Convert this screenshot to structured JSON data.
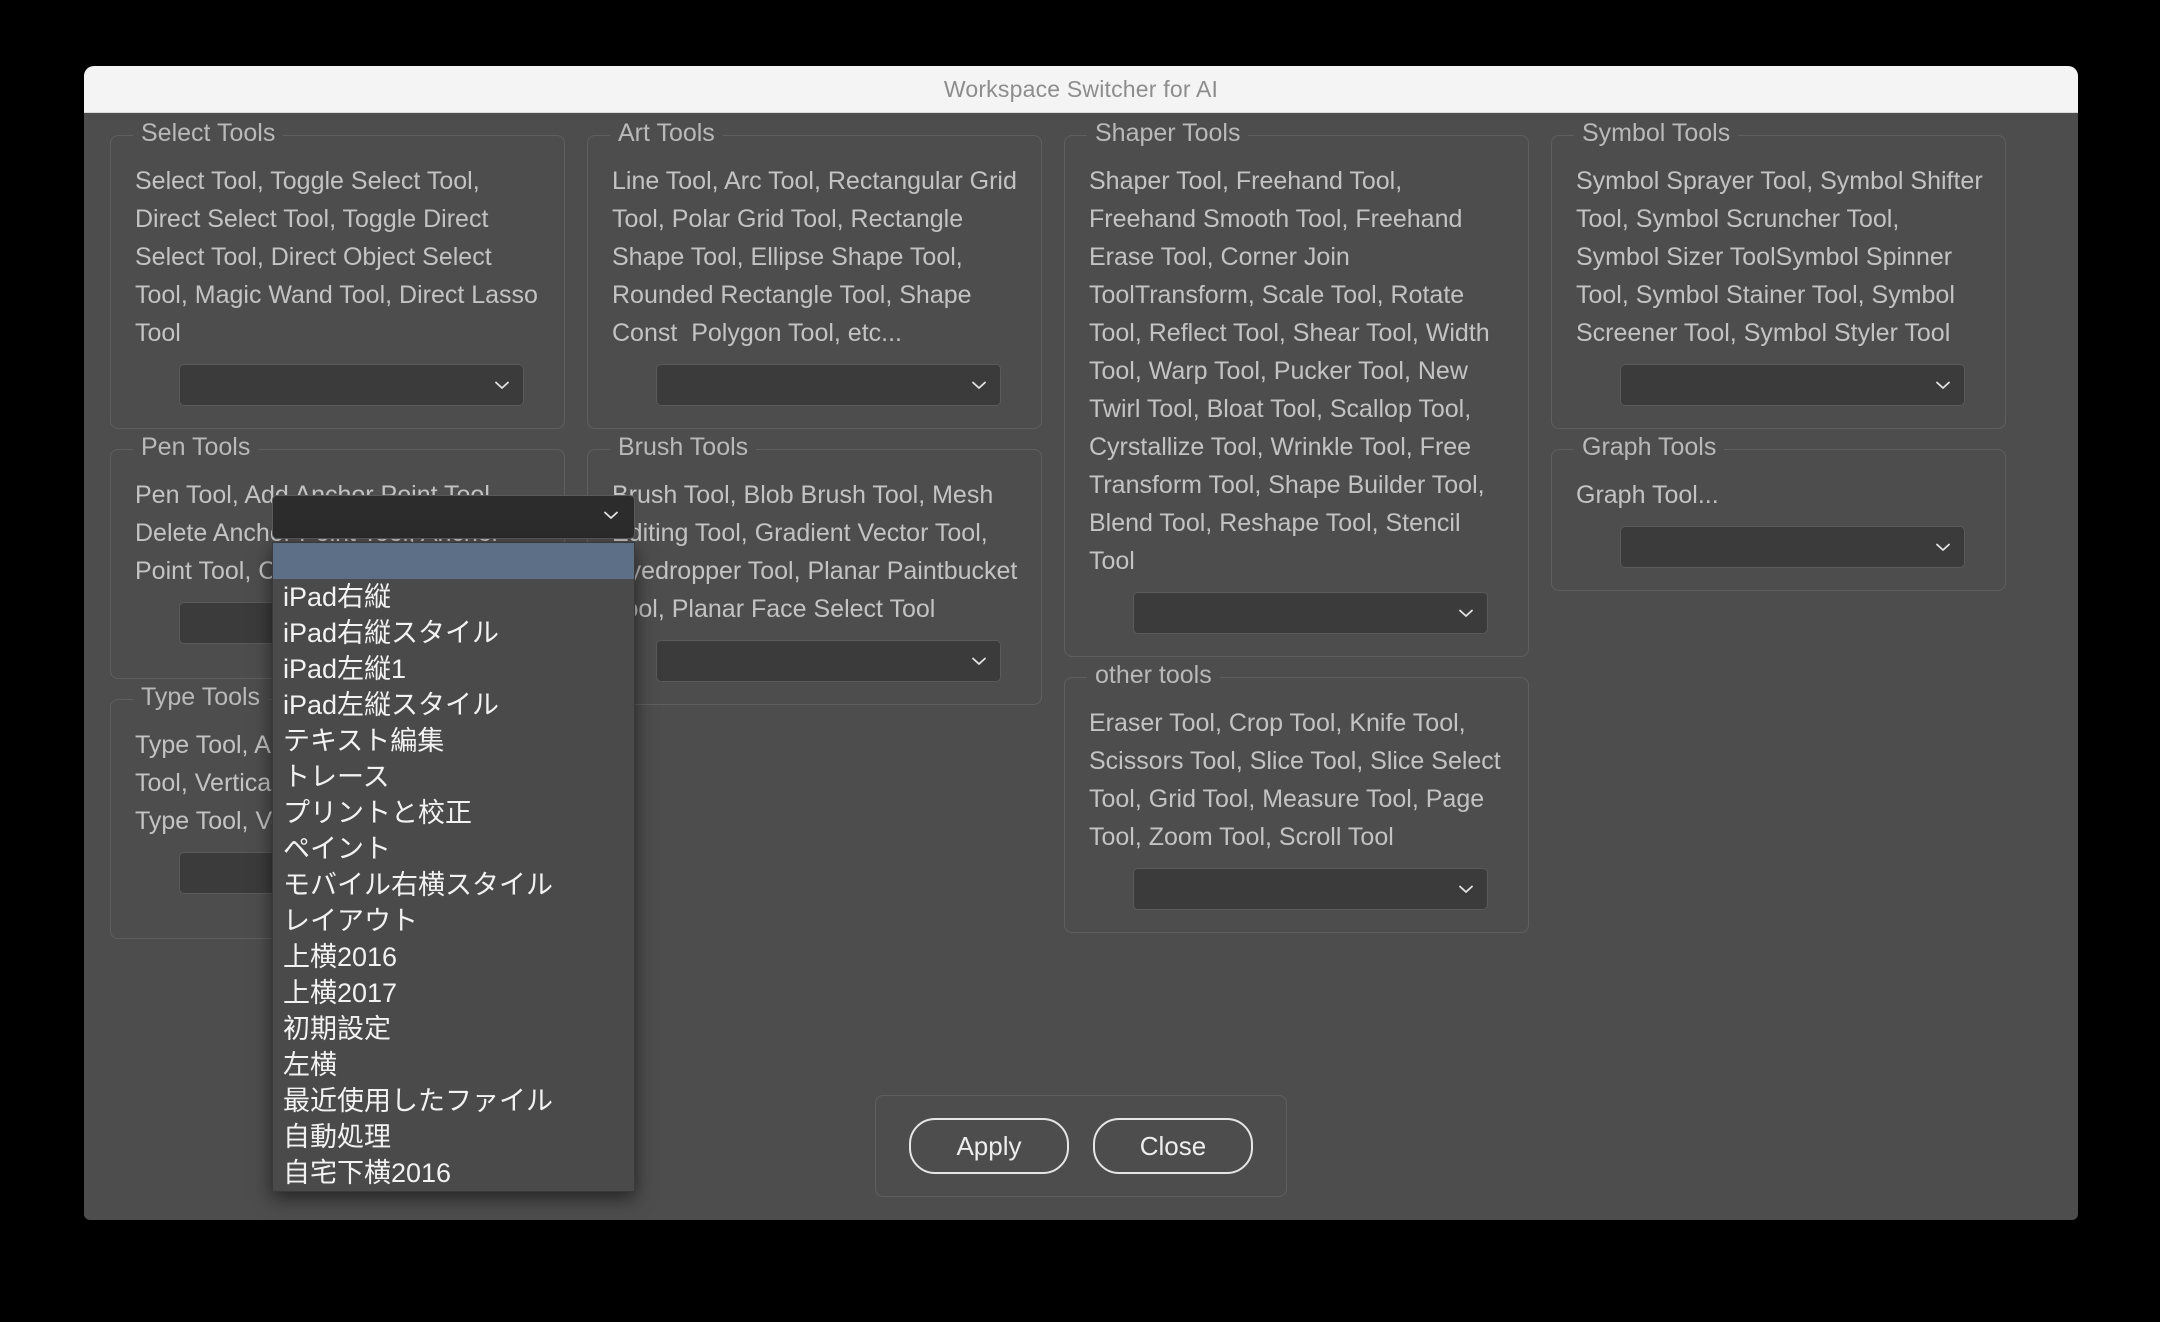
{
  "window": {
    "title": "Workspace Switcher for AI"
  },
  "groups": {
    "select_tools": {
      "legend": "Select Tools",
      "description": "Select Tool, Toggle Select Tool, Direct Select Tool, Toggle Direct Select Tool, Direct Object Select Tool, Magic Wand Tool, Direct Lasso Tool",
      "combo_value": ""
    },
    "pen_tools": {
      "legend": "Pen Tools",
      "description": "Pen Tool, Add Anchor Point Tool, Delete Anchor Point Tool, Anchor Point Tool, Curvature Tool",
      "combo_value": ""
    },
    "type_tools": {
      "legend": "Type Tools",
      "description": "Type Tool, Area Type Tool, Path Type Tool, Vertical Type Tool, Vertical Area Type Tool, Vertical Path Type Tool",
      "combo_value": ""
    },
    "art_tools": {
      "legend": "Art Tools",
      "description": "Line Tool, Arc Tool, Rectangular Grid Tool, Polar Grid Tool, Rectangle Shape Tool, Ellipse Shape Tool, Rounded Rectangle Tool, Shape Const  Polygon Tool, etc...",
      "combo_value": ""
    },
    "brush_tools": {
      "legend": "Brush Tools",
      "description": "Brush Tool, Blob Brush Tool, Mesh Editing Tool, Gradient Vector Tool, Eyedropper Tool, Planar Paintbucket Tool, Planar Face Select Tool",
      "combo_value": ""
    },
    "shaper_tools": {
      "legend": "Shaper Tools",
      "description": "Shaper Tool, Freehand Tool, Freehand Smooth Tool, Freehand Erase Tool, Corner Join ToolTransform, Scale Tool, Rotate Tool, Reflect Tool, Shear Tool, Width Tool, Warp Tool, Pucker Tool, New Twirl Tool, Bloat Tool, Scallop Tool, Cyrstallize Tool, Wrinkle Tool, Free Transform Tool, Shape Builder Tool, Blend Tool, Reshape Tool, Stencil Tool",
      "combo_value": ""
    },
    "other_tools": {
      "legend": "other tools",
      "description": "Eraser Tool, Crop Tool, Knife Tool, Scissors Tool, Slice Tool, Slice Select Tool, Grid Tool, Measure Tool, Page Tool, Zoom Tool, Scroll Tool",
      "combo_value": ""
    },
    "symbol_tools": {
      "legend": "Symbol Tools",
      "description": "Symbol Sprayer Tool, Symbol Shifter Tool, Symbol Scruncher Tool, Symbol Sizer ToolSymbol Spinner Tool, Symbol Stainer Tool, Symbol Screener Tool, Symbol Styler Tool",
      "combo_value": ""
    },
    "graph_tools": {
      "legend": "Graph Tools",
      "description": "Graph Tool...",
      "combo_value": ""
    }
  },
  "open_dropdown": {
    "owner": "select-tools-workspace-combo",
    "selected_value": "",
    "selected_index": 0,
    "options": [
      "",
      "iPad右縦",
      "iPad右縦スタイル",
      "iPad左縦1",
      "iPad左縦スタイル",
      "テキスト編集",
      "トレース",
      "プリントと校正",
      "ペイント",
      "モバイル右横スタイル",
      "レイアウト",
      "上横2016",
      "上横2017",
      "初期設定",
      "左横",
      "最近使用したファイル",
      "自動処理",
      "自宅下横2016"
    ]
  },
  "footer": {
    "apply_label": "Apply",
    "close_label": "Close"
  },
  "colors": {
    "window_bg": "#4d4d4d",
    "titlebar_bg": "#f4f4f4",
    "titlebar_text": "#8d8d8d",
    "group_border": "#5f5f5f",
    "body_text": "#c3c3c3",
    "dropdown_bg": "#4a4a4a",
    "dropdown_selected": "#5d6f86",
    "dropdown_text": "#f2f2f2",
    "button_border": "#e6e6e6",
    "desktop_bg": "#000000"
  }
}
